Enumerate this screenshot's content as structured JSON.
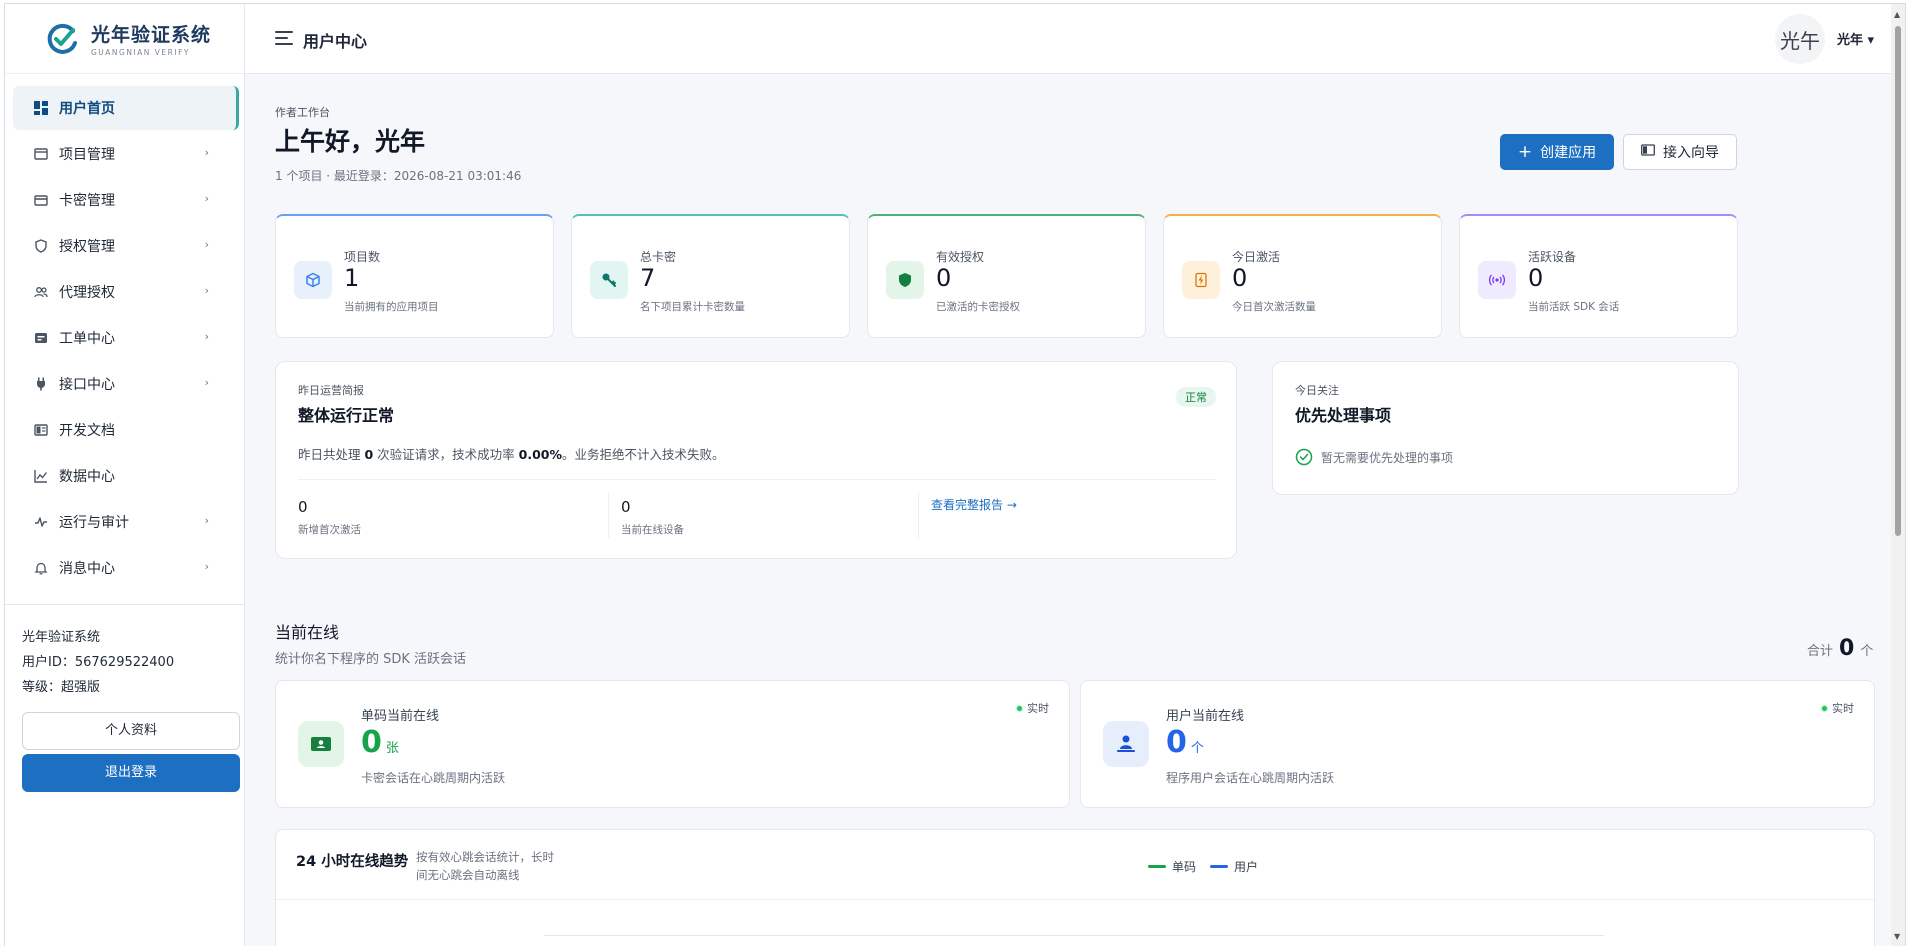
{
  "brand": {
    "name": "光年验证系统",
    "sub": "GUANGNIAN VERIFY"
  },
  "sidebar": {
    "items": [
      {
        "label": "用户首页",
        "icon": "dashboard-icon",
        "has_chevron": false
      },
      {
        "label": "项目管理",
        "icon": "folder-icon",
        "has_chevron": true
      },
      {
        "label": "卡密管理",
        "icon": "card-icon",
        "has_chevron": true
      },
      {
        "label": "授权管理",
        "icon": "shield-icon",
        "has_chevron": true
      },
      {
        "label": "代理授权",
        "icon": "users-icon",
        "has_chevron": true
      },
      {
        "label": "工单中心",
        "icon": "ticket-icon",
        "has_chevron": true
      },
      {
        "label": "接口中心",
        "icon": "plug-icon",
        "has_chevron": true
      },
      {
        "label": "开发文档",
        "icon": "book-icon",
        "has_chevron": false
      },
      {
        "label": "数据中心",
        "icon": "chart-icon",
        "has_chevron": false
      },
      {
        "label": "运行与审计",
        "icon": "pulse-icon",
        "has_chevron": true
      },
      {
        "label": "消息中心",
        "icon": "bell-icon",
        "has_chevron": true
      }
    ],
    "footer": {
      "system": "光年验证系统",
      "user_id": "用户ID：567629522400",
      "level": "等级：超强版",
      "profile_button": "个人资料",
      "logout_button": "退出登录"
    }
  },
  "header": {
    "title": "用户中心",
    "avatar_text": "光午",
    "username": "光年 ▾"
  },
  "main": {
    "kicker": "作者工作台",
    "greeting": "上午好，光年",
    "meta": "1 个项目  ·  最近登录：2026-08-21 03:01:46",
    "create_button": "创建应用",
    "guide_button": "接入向导",
    "stats": [
      {
        "label": "项目数",
        "value": "1",
        "desc": "当前拥有的应用项目",
        "color": "#3b82f6",
        "bg": "#e8f0fb",
        "icon": "cube-icon"
      },
      {
        "label": "总卡密",
        "value": "7",
        "desc": "名下项目累计卡密数量",
        "color": "#14b8a6",
        "bg": "#e2f5f3",
        "icon": "key-icon"
      },
      {
        "label": "有效授权",
        "value": "0",
        "desc": "已激活的卡密授权",
        "color": "#16a34a",
        "bg": "#e3f4e9",
        "icon": "shield-check-icon"
      },
      {
        "label": "今日激活",
        "value": "0",
        "desc": "今日首次激活数量",
        "color": "#f59e0b",
        "bg": "#fdf1dc",
        "icon": "bolt-icon"
      },
      {
        "label": "活跃设备",
        "value": "0",
        "desc": "当前活跃 SDK 会话",
        "color": "#8b5cf6",
        "bg": "#efeafd",
        "icon": "signal-icon"
      }
    ],
    "report": {
      "kicker": "昨日运营简报",
      "title": "整体运行正常",
      "badge": "正常",
      "line_prefix": "昨日共处理 ",
      "count": "0",
      "line_mid": " 次验证请求，技术成功率 ",
      "rate": "0.00%",
      "line_suffix": "。业务拒绝不计入技术失败。",
      "col1_value": "0",
      "col1_label": "新增首次激活",
      "col2_value": "0",
      "col2_label": "当前在线设备",
      "link": "查看完整报告 →"
    },
    "focus": {
      "kicker": "今日关注",
      "title": "优先处理事项",
      "empty": "暂无需要优先处理的事项"
    },
    "online": {
      "title": "当前在线",
      "subtitle": "统计你名下程序的 SDK 活跃会话",
      "total_label": "合计",
      "total_value": "0",
      "total_unit": "个",
      "cards": [
        {
          "label": "单码当前在线",
          "value": "0",
          "unit": "张",
          "desc": "卡密会话在心跳周期内活跃",
          "live": "实时",
          "color": "#16a34a",
          "bg": "#e3f4e9",
          "icon": "ticket-icon"
        },
        {
          "label": "用户当前在线",
          "value": "0",
          "unit": "个",
          "desc": "程序用户会话在心跳周期内活跃",
          "live": "实时",
          "color": "#2563eb",
          "bg": "#e6eefb",
          "icon": "user-icon"
        }
      ]
    },
    "trend": {
      "title": "24 小时在线趋势",
      "note": "按有效心跳会话统计，长时间无心跳会自动离线",
      "legend": [
        {
          "name": "单码",
          "color": "#16a34a"
        },
        {
          "name": "用户",
          "color": "#2563eb"
        }
      ]
    }
  }
}
